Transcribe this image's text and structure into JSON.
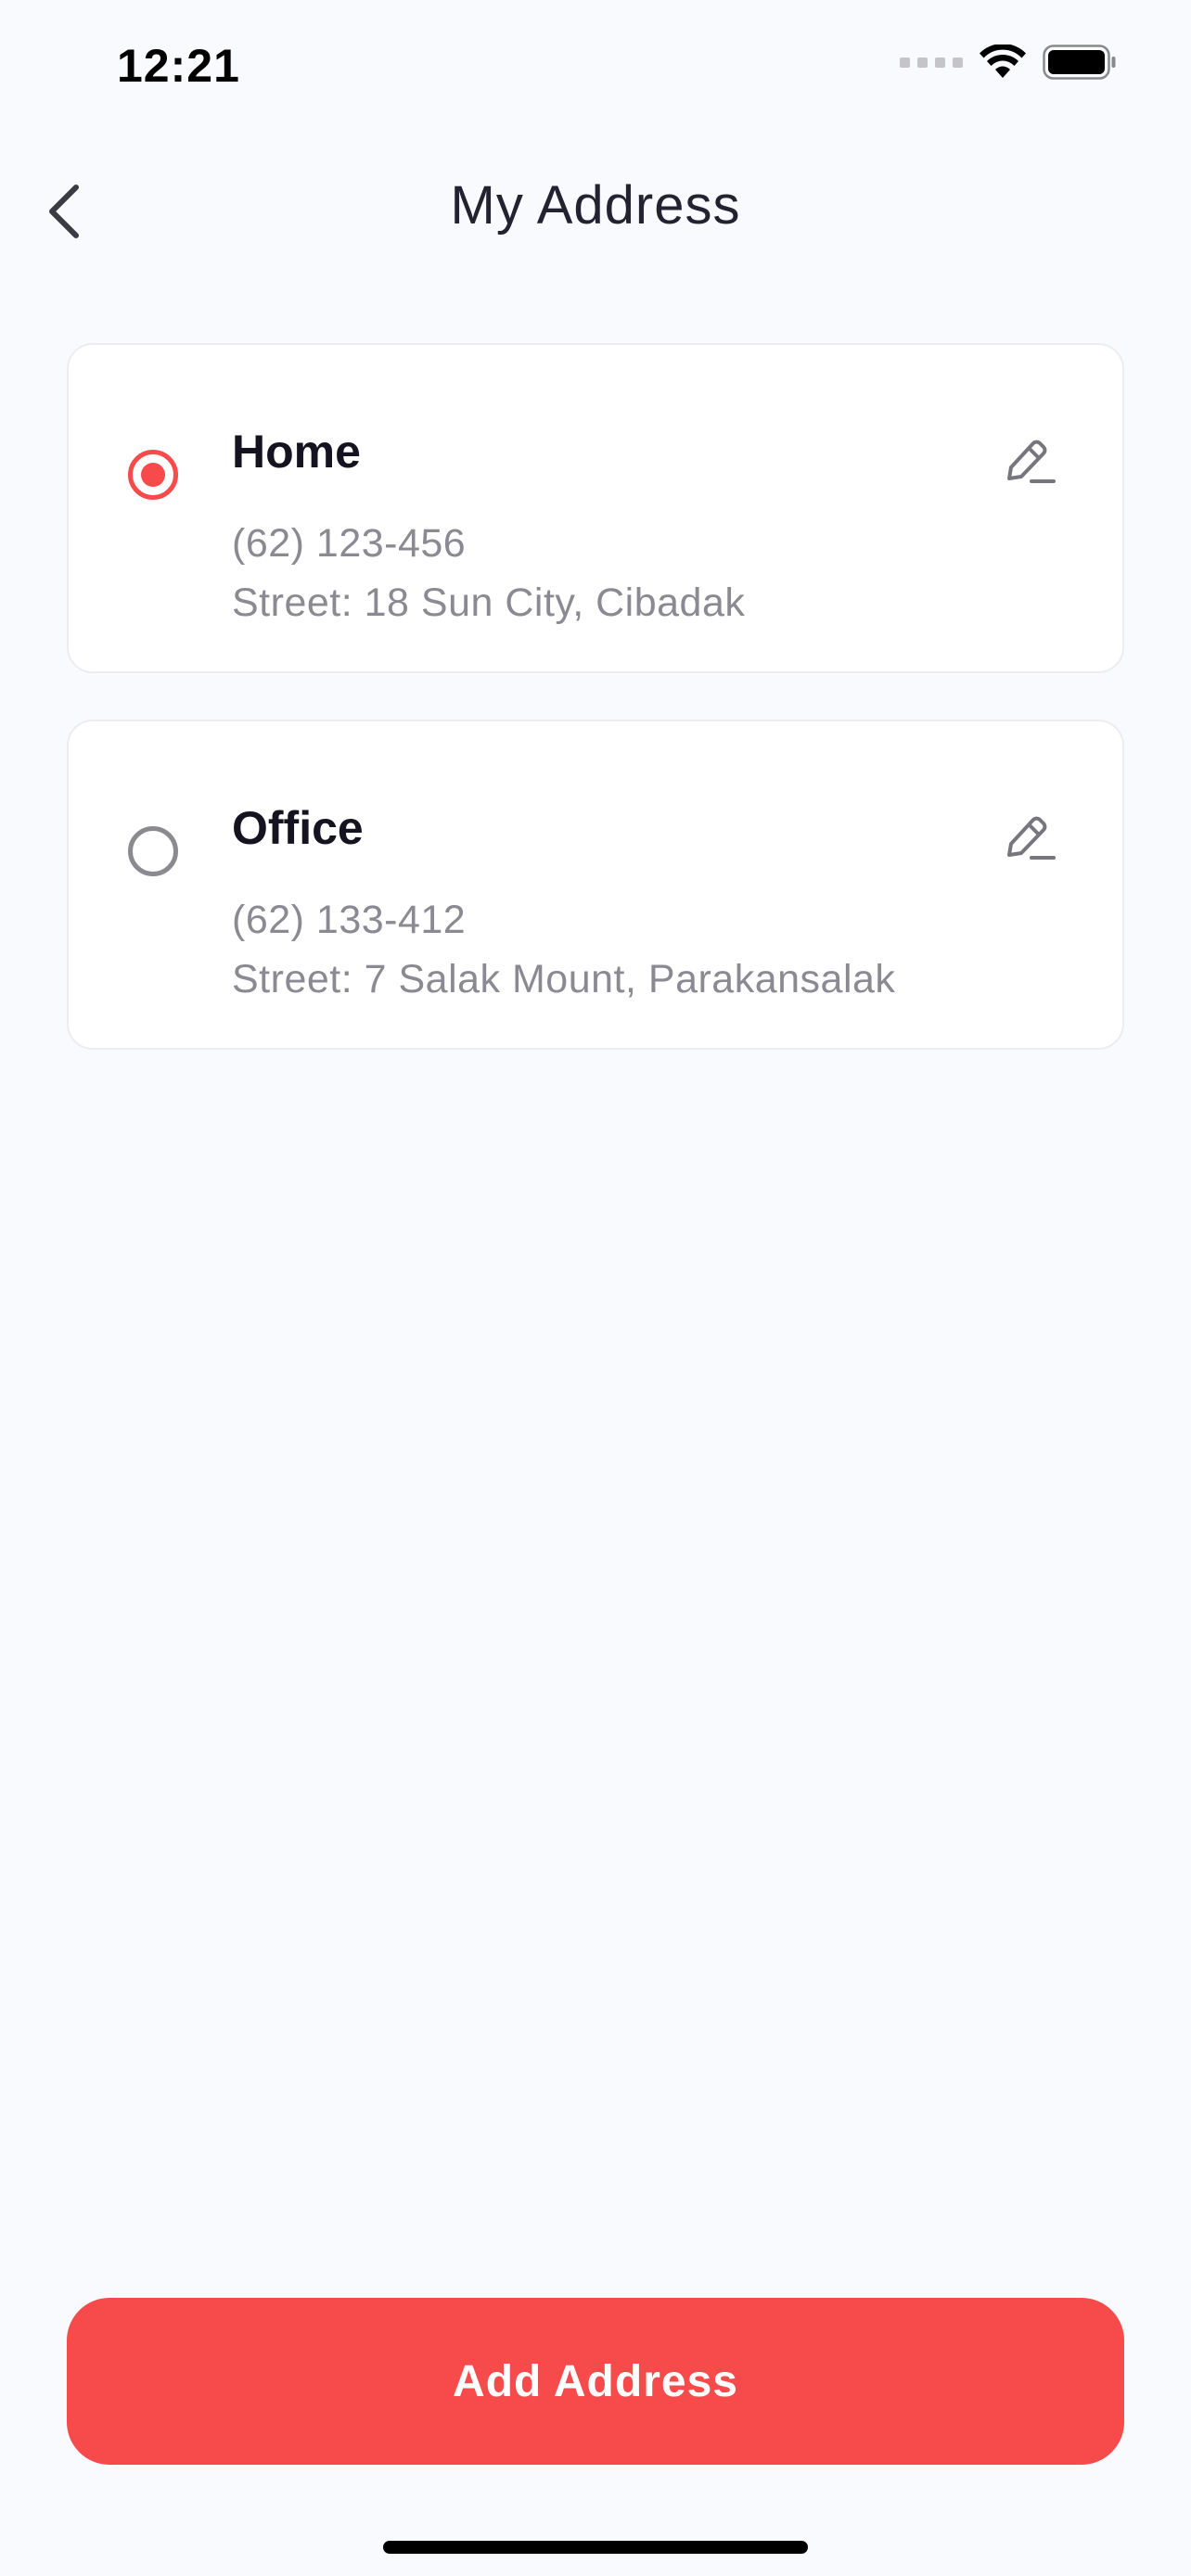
{
  "status_bar": {
    "time": "12:21",
    "icons": [
      "signal-icon",
      "wifi-icon",
      "battery-icon"
    ]
  },
  "header": {
    "title": "My Address",
    "back_icon": "chevron-left-icon"
  },
  "addresses": [
    {
      "label": "Home",
      "phone": "(62) 123-456",
      "street": "Street: 18 Sun City, Cibadak",
      "selected": true
    },
    {
      "label": "Office",
      "phone": "(62) 133-412",
      "street": "Street: 7 Salak Mount, Parakansalak",
      "selected": false
    }
  ],
  "actions": {
    "add_address_label": "Add Address"
  },
  "colors": {
    "accent": "#f64a4b",
    "background": "#f9fafd",
    "text_primary": "#14131f",
    "text_secondary": "#8b8a93"
  }
}
